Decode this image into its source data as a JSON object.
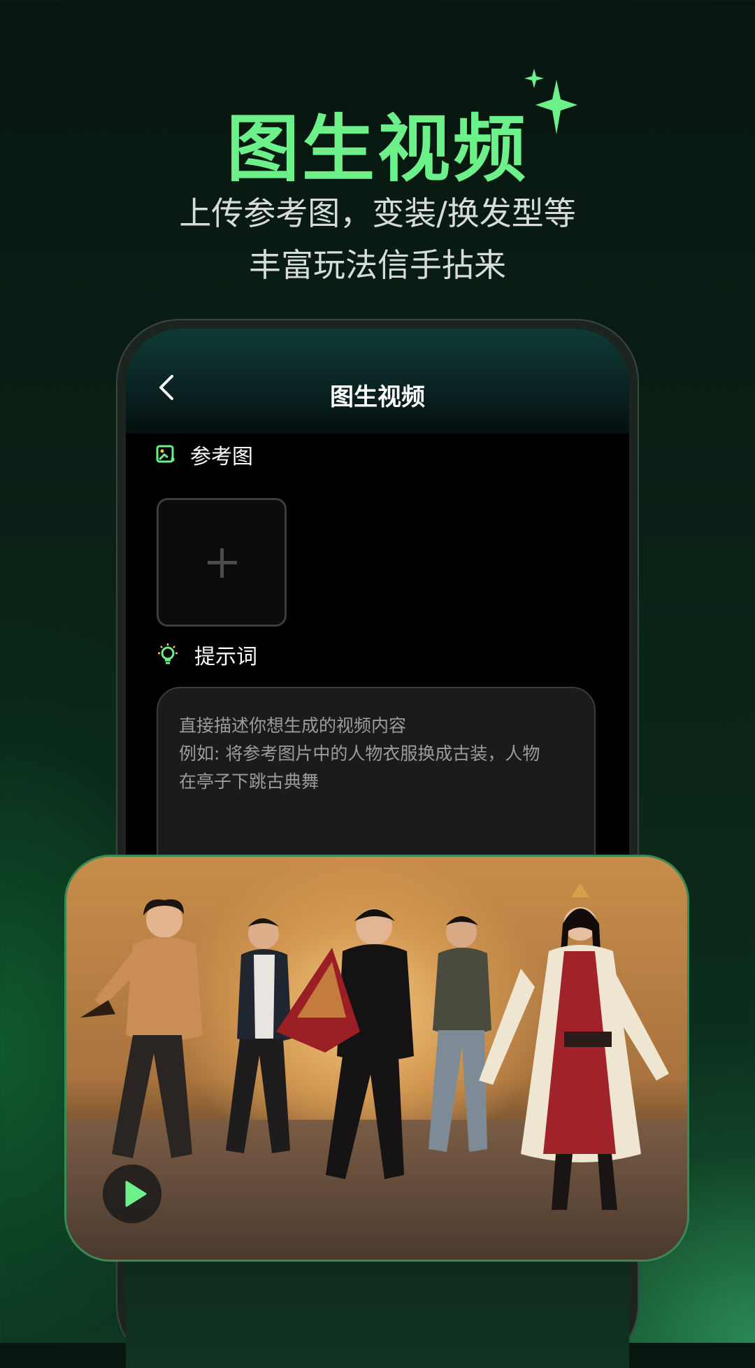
{
  "hero": {
    "title": "图生视频",
    "subtitle_line1": "上传参考图，变装/换发型等",
    "subtitle_line2": "丰富玩法信手拈来"
  },
  "screen": {
    "title": "图生视频",
    "reference_label": "参考图",
    "prompt_label": "提示词",
    "prompt_placeholder_line1": "直接描述你想生成的视频内容",
    "prompt_placeholder_line2": "例如: 将参考图片中的人物衣服换成古装，人物",
    "prompt_placeholder_line3": "在亭子下跳古典舞"
  },
  "colors": {
    "accent_green": "#6cf08a",
    "background_dark": "#07160f"
  },
  "icons": {
    "back": "chevron-left-icon",
    "reference": "image-icon",
    "prompt": "lightbulb-icon",
    "upload": "plus-icon",
    "play": "play-icon",
    "sparkle": "sparkle-icon"
  }
}
